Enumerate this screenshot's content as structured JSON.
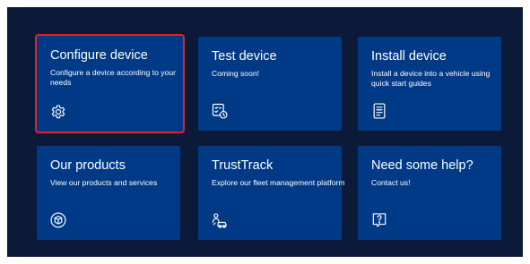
{
  "colors": {
    "background": "#0b1a38",
    "card": "#003a86",
    "text": "#ffffff",
    "selection_outline": "#e02424"
  },
  "cards": [
    {
      "title": "Configure device",
      "description": "Configure a device according to your needs",
      "icon": "gear-icon",
      "selected": true
    },
    {
      "title": "Test device",
      "description": "Coming soon!",
      "icon": "checklist-clock-icon",
      "selected": false
    },
    {
      "title": "Install device",
      "description": "Install a device into a vehicle using quick start guides",
      "icon": "document-icon",
      "selected": false
    },
    {
      "title": "Our products",
      "description": "View our products and services",
      "icon": "package-icon",
      "selected": false
    },
    {
      "title": "TrustTrack",
      "description": "Explore our fleet management platform",
      "icon": "fleet-icon",
      "selected": false
    },
    {
      "title": "Need some help?",
      "description": "Contact us!",
      "icon": "question-icon",
      "selected": false
    }
  ]
}
